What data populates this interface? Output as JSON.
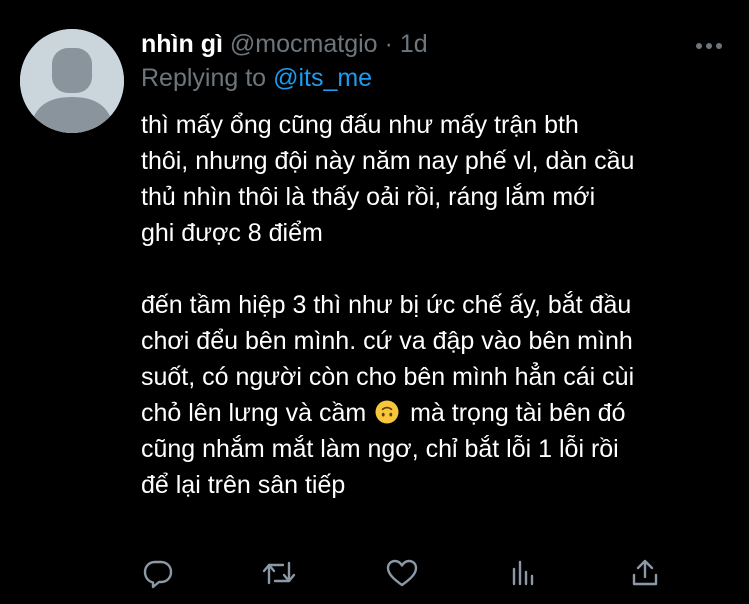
{
  "tweet": {
    "display_name": "nhìn gì",
    "handle": "@mocmatgio",
    "separator": "·",
    "time": "1d",
    "reply_prefix": "Replying to",
    "reply_target": "@its_me",
    "paragraph1": {
      "line1": "thì mấy ổng cũng đấu như mấy trận bth",
      "line2": "thôi, nhưng đội này năm nay phế vl, dàn cầu",
      "line3": "thủ nhìn thôi là thấy oải rồi, ráng lắm mới",
      "line4": "ghi được 8 điểm"
    },
    "paragraph2": {
      "line1": "đến tầm hiệp 3 thì như bị ức chế ấy, bắt đầu",
      "line2": "chơi đểu bên mình. cứ va đập vào bên mình",
      "line3": "suốt, có người còn cho bên mình hẳn cái cùi",
      "line4a": "chỏ lên lưng và cầm",
      "emoji": "upside-down-face-emoji",
      "line4b": " mà trọng tài bên đó",
      "line5": "cũng nhắm mắt làm ngơ, chỉ bắt lỗi 1 lỗi rồi",
      "line6": "để lại trên sân tiếp"
    }
  },
  "icons": {
    "more": "more-horizontal-icon",
    "reply": "reply-bubble-icon",
    "retweet": "retweet-icon",
    "like": "heart-icon",
    "analytics": "analytics-bars-icon",
    "share": "share-upload-icon"
  },
  "colors": {
    "background": "#000000",
    "text": "#ffffff",
    "muted": "#6e767d",
    "link": "#1d9bf0",
    "avatar_bg": "#cbd5dc",
    "avatar_fg": "#8a949c"
  }
}
